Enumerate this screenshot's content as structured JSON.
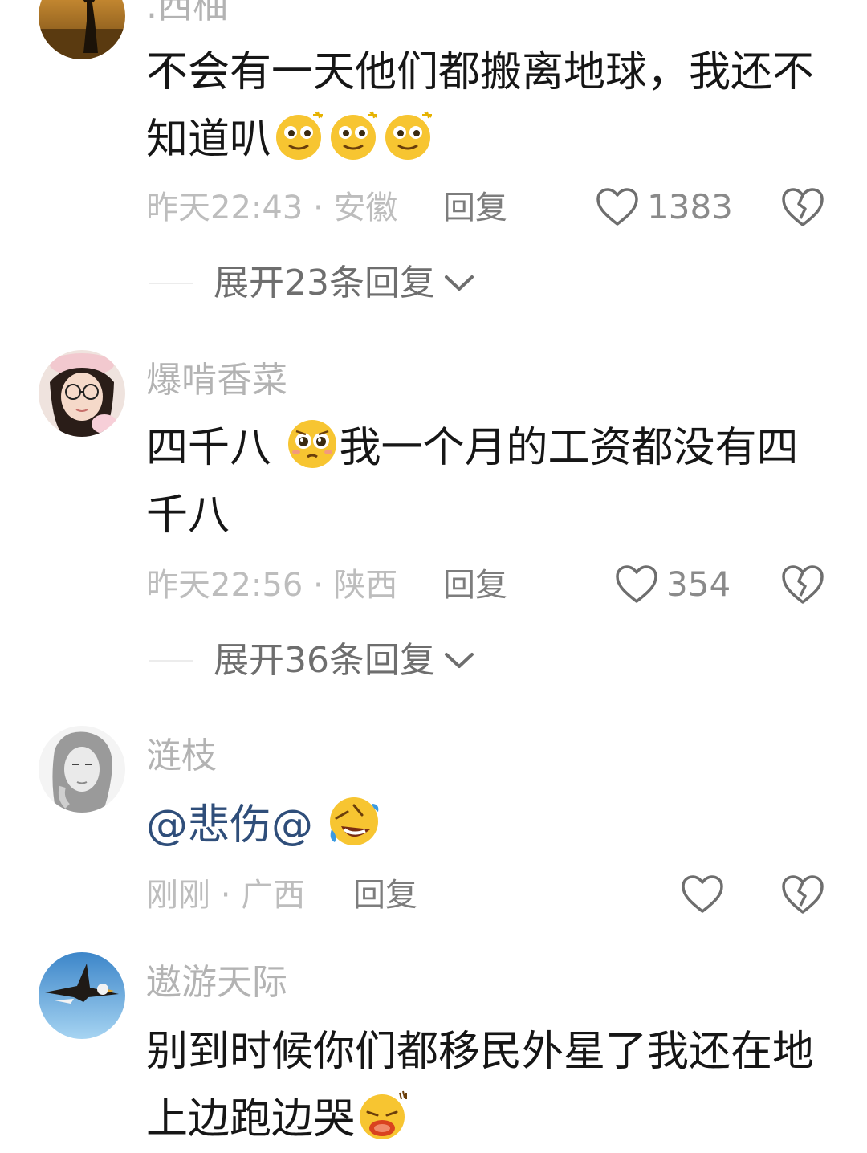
{
  "comments": [
    {
      "username": ".西柚",
      "avatar_icon": "sunset-silhouette-avatar",
      "text": "不会有一天他们都搬离地球，我还不知道叭",
      "emojis": [
        "sparkle-eyes-face-icon",
        "sparkle-eyes-face-icon",
        "sparkle-eyes-face-icon"
      ],
      "time": "昨天22:43",
      "location": "安徽",
      "reply_label": "回复",
      "like_count": "1383",
      "expand_label": "展开23条回复"
    },
    {
      "username": "爆啃香菜",
      "avatar_icon": "girl-glasses-avatar",
      "text_part1": "四千八",
      "emoji": "pleading-face-icon",
      "text_part2": "我一个月的工资都没有四千八",
      "time": "昨天22:56",
      "location": "陕西",
      "reply_label": "回复",
      "like_count": "354",
      "expand_label": "展开36条回复"
    },
    {
      "username": "涟枝",
      "avatar_icon": "sketch-girl-avatar",
      "mention": "@悲伤@",
      "emoji": "rolling-laughing-face-icon",
      "time": "刚刚",
      "location": "广西",
      "reply_label": "回复",
      "like_count": ""
    },
    {
      "username": "遨游天际",
      "avatar_icon": "eagle-avatar",
      "text": "别到时候你们都移民外星了我还在地上边跑边哭",
      "emoji": "crying-mouth-face-icon"
    }
  ],
  "separator": " · ",
  "colors": {
    "username": "#b3b3b3",
    "text": "#161616",
    "meta": "#bdbdbd",
    "mention": "#2f4e7a",
    "emoji": "#f7c531"
  }
}
